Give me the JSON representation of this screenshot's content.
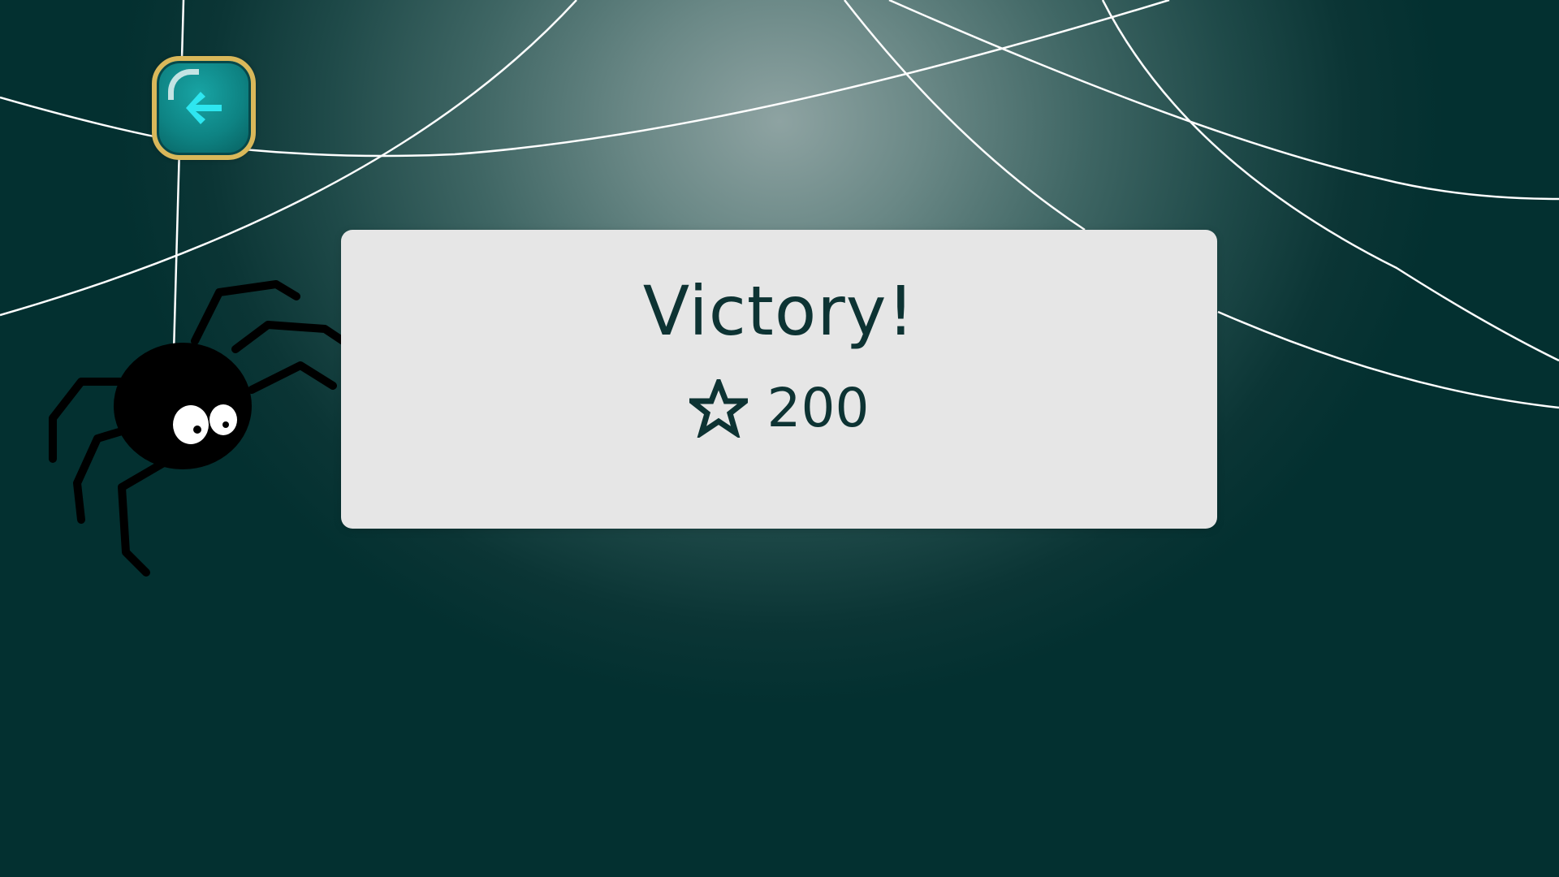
{
  "dialog": {
    "title": "Victory!",
    "score": "200"
  },
  "icons": {
    "back": "arrow-left-icon",
    "score": "star-icon",
    "character": "spider"
  },
  "colors": {
    "background_center": "#8ea3a2",
    "background_edge": "#033030",
    "dialog_bg": "#e6e6e6",
    "text": "#0d3333",
    "button_fill": "#0e8383",
    "button_border": "#d9b85a",
    "arrow": "#2ee6f0",
    "web": "#ffffff"
  }
}
